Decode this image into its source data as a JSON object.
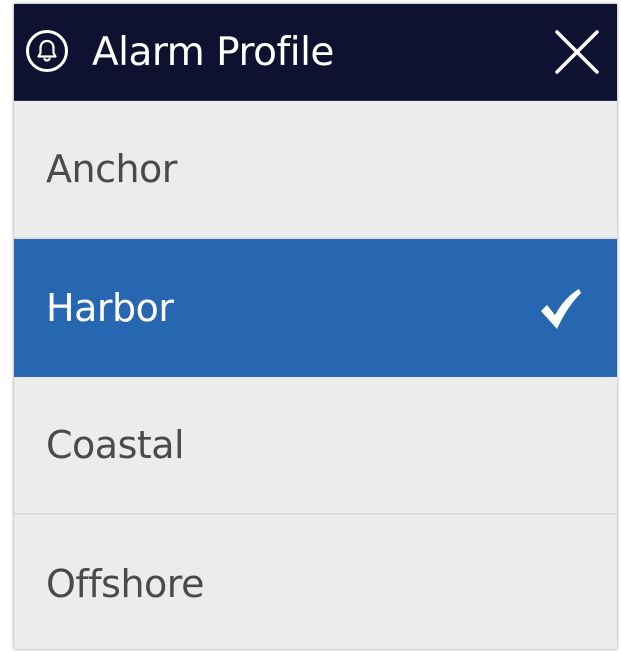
{
  "dialog": {
    "title": "Alarm Profile",
    "header_icon": "bell-icon",
    "close_icon": "close-icon"
  },
  "options": [
    {
      "label": "Anchor",
      "selected": false
    },
    {
      "label": "Harbor",
      "selected": true
    },
    {
      "label": "Coastal",
      "selected": false
    },
    {
      "label": "Offshore",
      "selected": false
    }
  ],
  "colors": {
    "header_bg": "#0e1130",
    "selected_bg": "#2766b0",
    "list_bg": "#ececec",
    "text": "#4a4a4a"
  }
}
